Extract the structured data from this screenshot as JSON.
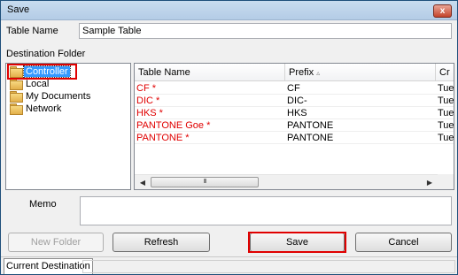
{
  "window": {
    "title": "Save",
    "close_glyph": "x"
  },
  "table_name": {
    "label": "Table Name",
    "value": "Sample Table"
  },
  "destination": {
    "label": "Destination Folder",
    "folders": [
      {
        "label": "Controller",
        "selected": true
      },
      {
        "label": "Local",
        "selected": false
      },
      {
        "label": "My Documents",
        "selected": false
      },
      {
        "label": "Network",
        "selected": false
      }
    ]
  },
  "grid": {
    "columns": [
      "Table Name",
      "Prefix",
      "Cr"
    ],
    "sort_glyph": "▵",
    "rows": [
      {
        "name": "CF  *",
        "prefix": "CF",
        "created": "Tue"
      },
      {
        "name": "DIC  *",
        "prefix": "DIC-",
        "created": "Tue"
      },
      {
        "name": "HKS  *",
        "prefix": "HKS",
        "created": "Tue"
      },
      {
        "name": "PANTONE Goe  *",
        "prefix": "PANTONE",
        "created": "Tue"
      },
      {
        "name": "PANTONE  *",
        "prefix": "PANTONE",
        "created": "Tue"
      }
    ],
    "scroll": {
      "left": "◀",
      "right": "▶",
      "thumb": "III"
    }
  },
  "memo": {
    "label": "Memo",
    "value": ""
  },
  "buttons": {
    "new_folder": "New Folder",
    "refresh": "Refresh",
    "save": "Save",
    "cancel": "Cancel"
  },
  "status": {
    "current_destination": "Current Destination"
  },
  "colors": {
    "highlight": "#e00000",
    "selection": "#3399ff"
  }
}
